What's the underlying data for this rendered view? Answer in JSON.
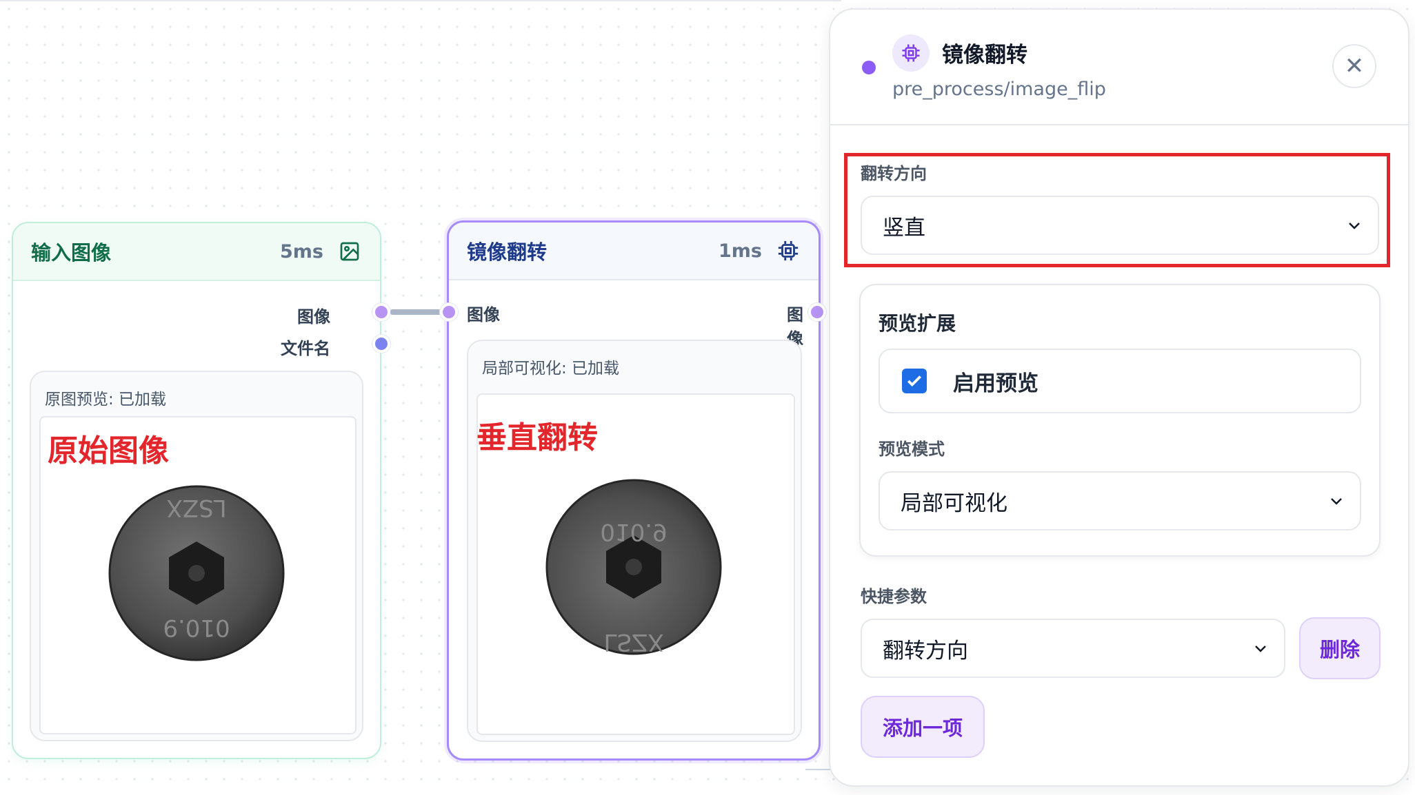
{
  "nodes": {
    "input": {
      "title": "输入图像",
      "time": "5ms",
      "ports": {
        "out_image": "图像",
        "out_filename": "文件名"
      },
      "preview_caption": "原图预览: 已加载",
      "overlay_label": "原始图像"
    },
    "flip": {
      "title": "镜像翻转",
      "time": "1ms",
      "ports": {
        "in_image": "图像",
        "out_image": "图像"
      },
      "preview_caption": "局部可视化: 已加载",
      "overlay_label": "垂直翻转"
    }
  },
  "panel": {
    "title": "镜像翻转",
    "path": "pre_process/image_flip",
    "close_label": "✕",
    "flip_direction": {
      "label": "翻转方向",
      "value": "竖直"
    },
    "preview_ext": {
      "title": "预览扩展",
      "enable_label": "启用预览",
      "enabled": true,
      "mode_label": "预览模式",
      "mode_value": "局部可视化"
    },
    "shortcut": {
      "label": "快捷参数",
      "value": "翻转方向",
      "delete_label": "删除",
      "add_label": "添加一项"
    }
  },
  "colors": {
    "accent_purple": "#8b5cf6",
    "highlight_red": "#e3262b",
    "input_green": "#0f6e49",
    "flip_blue": "#1e3a8a"
  },
  "icons": [
    "image-icon",
    "chip-icon",
    "close-icon",
    "chevron-down-icon",
    "checkmark-icon"
  ]
}
